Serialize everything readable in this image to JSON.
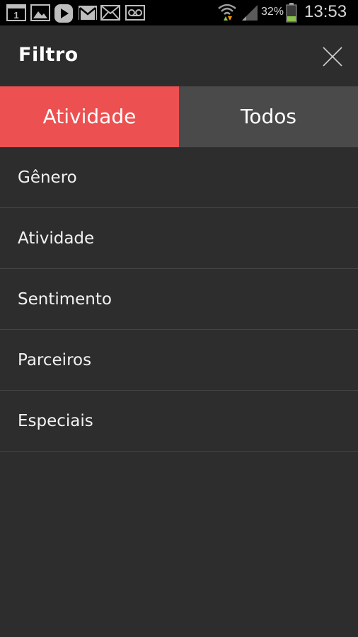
{
  "status_bar": {
    "notification_icons": [
      "calendar-1-icon",
      "gallery-icon",
      "play-store-icon",
      "gmail-icon",
      "email-icon",
      "voicemail-icon"
    ],
    "calendar_day": "1",
    "battery_percent": "32%",
    "battery_level": 0.32,
    "time": "13:53"
  },
  "header": {
    "title": "Filtro",
    "close_icon": "close-icon"
  },
  "tabs": [
    {
      "label": "Atividade",
      "active": true
    },
    {
      "label": "Todos",
      "active": false
    }
  ],
  "filters": [
    {
      "label": "Gênero"
    },
    {
      "label": "Atividade"
    },
    {
      "label": "Sentimento"
    },
    {
      "label": "Parceiros"
    },
    {
      "label": "Especiais"
    }
  ],
  "colors": {
    "accent": "#ec5050",
    "background": "#2d2d2d",
    "inactive_tab": "#4a4a4a",
    "battery": "#8bc34a"
  }
}
